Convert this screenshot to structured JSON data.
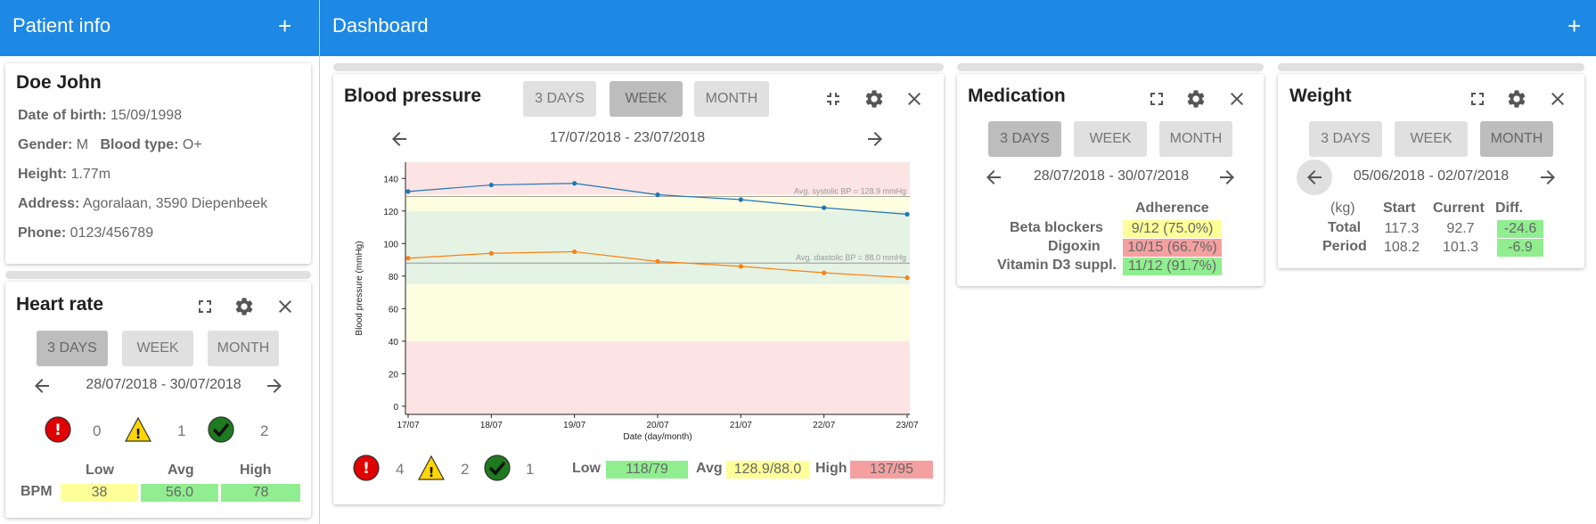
{
  "left_header": {
    "title": "Patient info",
    "add_icon": "plus-icon"
  },
  "right_header": {
    "title": "Dashboard",
    "add_icon": "plus-icon"
  },
  "patient": {
    "name": "Doe John",
    "dob_label": "Date of birth:",
    "dob": "15/09/1998",
    "gender_label": "Gender:",
    "gender": "M",
    "blood_label": "Blood type:",
    "blood": "O+",
    "height_label": "Height:",
    "height": "1.77m",
    "address_label": "Address:",
    "address": "Agoralaan, 3590 Diepenbeek",
    "phone_label": "Phone:",
    "phone": "0123/456789"
  },
  "periods": [
    "3 DAYS",
    "WEEK",
    "MONTH"
  ],
  "heart_rate": {
    "title": "Heart rate",
    "active_period": "3 DAYS",
    "date_range": "28/07/2018 - 30/07/2018",
    "counts": {
      "critical": "0",
      "warning": "1",
      "ok": "2"
    },
    "table": {
      "row_label": "BPM",
      "headers": [
        "Low",
        "Avg",
        "High"
      ],
      "values": [
        "38",
        "56.0",
        "78"
      ]
    }
  },
  "blood_pressure": {
    "title": "Blood pressure",
    "active_period": "WEEK",
    "date_range": "17/07/2018 - 23/07/2018",
    "counts": {
      "critical": "4",
      "warning": "2",
      "ok": "1"
    },
    "summary": {
      "low_label": "Low",
      "low": "118/79",
      "avg_label": "Avg",
      "avg": "128.9/88.0",
      "high_label": "High",
      "high": "137/95"
    }
  },
  "medication": {
    "title": "Medication",
    "active_period": "3 DAYS",
    "date_range": "28/07/2018 - 30/07/2018",
    "header": "Adherence",
    "rows": [
      {
        "name": "Beta blockers",
        "value": "9/12 (75.0%)",
        "status": "yellow"
      },
      {
        "name": "Digoxin",
        "value": "10/15 (66.7%)",
        "status": "red"
      },
      {
        "name": "Vitamin D3 suppl.",
        "value": "11/12 (91.7%)",
        "status": "green"
      }
    ]
  },
  "weight": {
    "title": "Weight",
    "active_period": "MONTH",
    "date_range": "05/06/2018 - 02/07/2018",
    "headers": [
      "(kg)",
      "Start",
      "Current",
      "Diff."
    ],
    "rows": [
      {
        "label": "Total",
        "start": "117.3",
        "current": "92.7",
        "diff": "-24.6"
      },
      {
        "label": "Period",
        "start": "108.2",
        "current": "101.3",
        "diff": "-6.9"
      }
    ]
  },
  "colors": {
    "appbar": "#1e88e5",
    "systolic": "#1f77b4",
    "diastolic": "#ff7f0e",
    "good": "#90ee90",
    "warn": "#ffff99",
    "bad": "#f4a0a0"
  },
  "chart_data": {
    "type": "line",
    "xlabel": "Date (day/month)",
    "ylabel": "Blood pressure (mmHg)",
    "categories": [
      "17/07",
      "18/07",
      "19/07",
      "20/07",
      "21/07",
      "22/07",
      "23/07"
    ],
    "ylim": [
      -5,
      150
    ],
    "yticks": [
      0,
      20,
      40,
      60,
      80,
      100,
      120,
      140
    ],
    "series": [
      {
        "name": "systolic",
        "values": [
          132,
          136,
          137,
          130,
          127,
          122,
          118
        ]
      },
      {
        "name": "diastolic",
        "values": [
          91,
          94,
          95,
          89,
          86,
          82,
          79
        ]
      }
    ],
    "reference_lines": [
      {
        "label": "Avg. systolic BP = 128.9 mmHg",
        "value": 128.9
      },
      {
        "label": "Avg. diastolic BP = 88.0 mmHg",
        "value": 88.0
      }
    ],
    "bands": [
      {
        "from": -5,
        "to": 40,
        "color": "red"
      },
      {
        "from": 40,
        "to": 75,
        "color": "yellow"
      },
      {
        "from": 75,
        "to": 120,
        "color": "green"
      },
      {
        "from": 120,
        "to": 130,
        "color": "yellow"
      },
      {
        "from": 130,
        "to": 150,
        "color": "red"
      }
    ]
  }
}
